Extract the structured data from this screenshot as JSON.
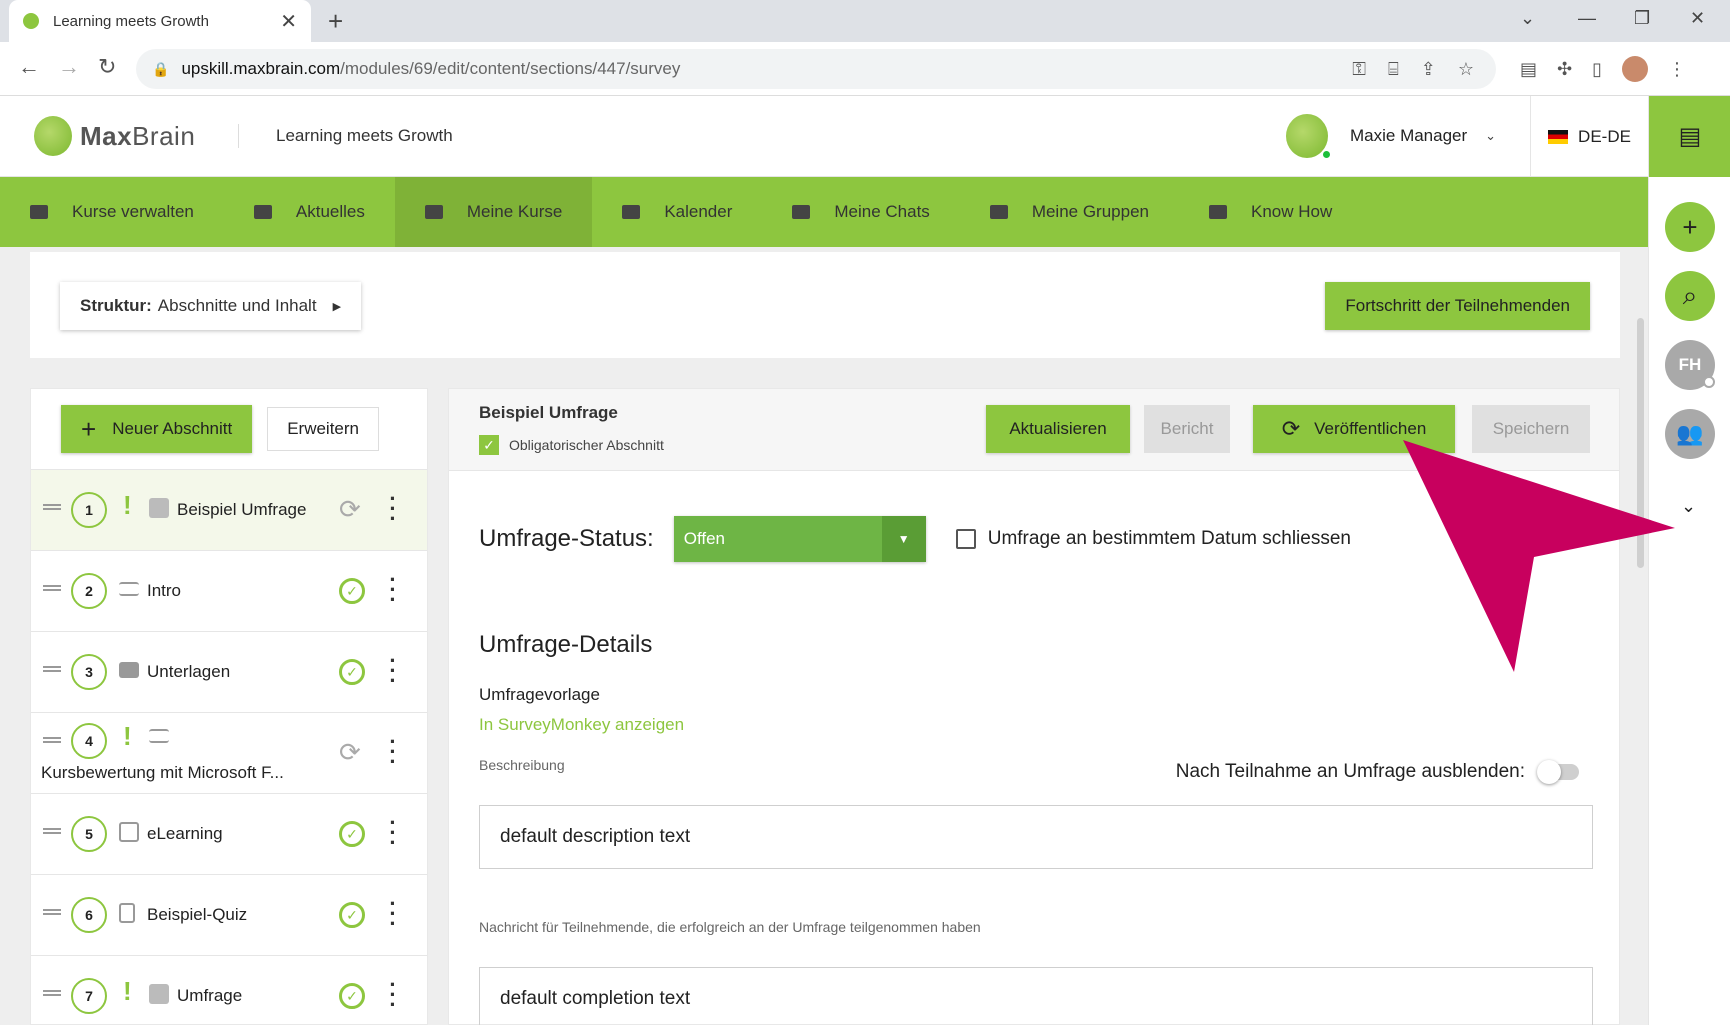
{
  "browser": {
    "tab_title": "Learning meets Growth",
    "url_host": "upskill.maxbrain.com",
    "url_path": "/modules/69/edit/content/sections/447/survey"
  },
  "header": {
    "logo_max": "Max",
    "logo_brain": "Brain",
    "title": "Learning meets Growth",
    "user_name": "Maxie Manager",
    "language": "DE-DE"
  },
  "nav": [
    {
      "label": "Kurse verwalten"
    },
    {
      "label": "Aktuelles"
    },
    {
      "label": "Meine Kurse"
    },
    {
      "label": "Kalender"
    },
    {
      "label": "Meine Chats"
    },
    {
      "label": "Meine Gruppen"
    },
    {
      "label": "Know How"
    }
  ],
  "rail": {
    "avatar_initials": "FH"
  },
  "structure": {
    "label_bold": "Struktur:",
    "label": "Abschnitte und Inhalt",
    "progress_button": "Fortschritt der Teilnehmenden"
  },
  "sections_panel": {
    "new_section": "Neuer Abschnitt",
    "expand": "Erweitern",
    "items": [
      {
        "num": "1",
        "label": "Beispiel Umfrage",
        "mandatory": true,
        "status": "sync"
      },
      {
        "num": "2",
        "label": "Intro",
        "mandatory": false,
        "status": "ok"
      },
      {
        "num": "3",
        "label": "Unterlagen",
        "mandatory": false,
        "status": "ok"
      },
      {
        "num": "4",
        "label": "Kursbewertung mit Microsoft F...",
        "mandatory": true,
        "status": "sync"
      },
      {
        "num": "5",
        "label": "eLearning",
        "mandatory": false,
        "status": "ok"
      },
      {
        "num": "6",
        "label": "Beispiel-Quiz",
        "mandatory": false,
        "status": "ok"
      },
      {
        "num": "7",
        "label": "Umfrage",
        "mandatory": true,
        "status": "ok"
      }
    ]
  },
  "editor": {
    "title": "Beispiel Umfrage",
    "mandatory_label": "Obligatorischer Abschnitt",
    "btn_update": "Aktualisieren",
    "btn_report": "Bericht",
    "btn_publish": "Veröffentlichen",
    "btn_save": "Speichern",
    "status_label": "Umfrage-Status:",
    "status_value": "Offen",
    "close_on_date": "Umfrage an bestimmtem Datum schliessen",
    "details_heading": "Umfrage-Details",
    "template_label": "Umfragevorlage",
    "template_link": "In SurveyMonkey anzeigen",
    "description_label": "Beschreibung",
    "hide_after_label": "Nach Teilnahme an Umfrage ausblenden:",
    "description_value": "default description text",
    "completion_label": "Nachricht für Teilnehmende, die erfolgreich an der Umfrage teilgenommen haben",
    "completion_value": "default completion text"
  },
  "colors": {
    "brand_green": "#8dc63f",
    "select_green": "#6eb545",
    "annotation_pink": "#c8005e"
  }
}
